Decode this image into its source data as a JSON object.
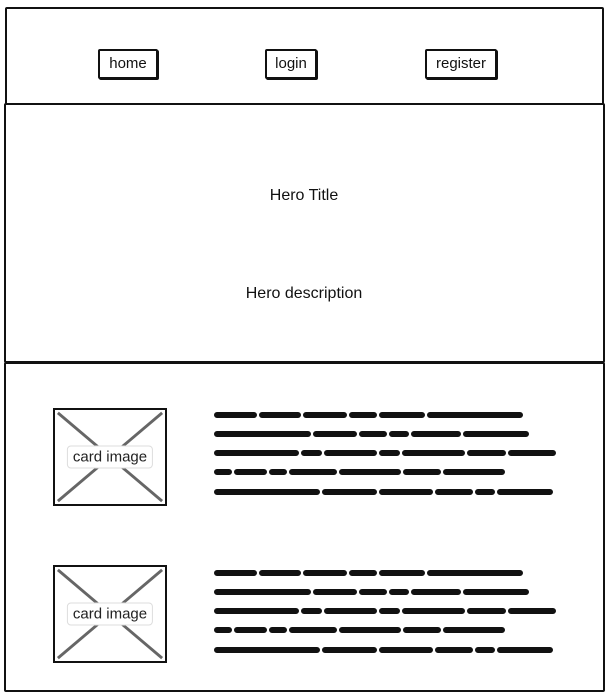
{
  "nav": {
    "home_label": "home",
    "login_label": "login",
    "register_label": "register"
  },
  "hero": {
    "title": "Hero Title",
    "description": "Hero description"
  },
  "cards": [
    {
      "image_label": "card image"
    },
    {
      "image_label": "card image"
    }
  ],
  "colors": {
    "stroke": "#111111",
    "placeholder_cross": "#666666",
    "background": "#ffffff"
  },
  "icons": {
    "image_placeholder": "image-placeholder-icon"
  }
}
